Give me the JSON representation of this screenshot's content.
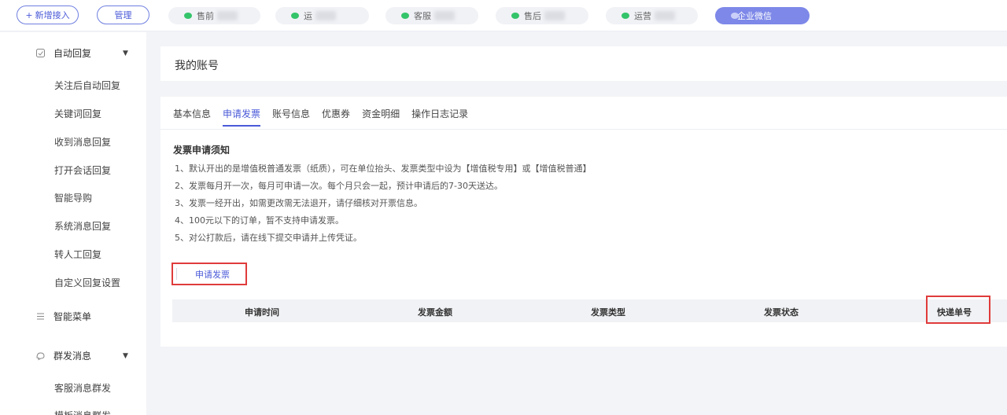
{
  "topbar": {
    "add_label": "新增接入",
    "manage_label": "管理",
    "accounts": [
      {
        "name": "售前"
      },
      {
        "name": "运"
      },
      {
        "name": "客服"
      },
      {
        "name": "售后"
      },
      {
        "name": "运营"
      },
      {
        "name": "企业微信",
        "active": true
      }
    ]
  },
  "sidebar": {
    "group1": {
      "label": "自动回复",
      "icon": "reply-icon"
    },
    "items1": [
      "关注后自动回复",
      "关键词回复",
      "收到消息回复",
      "打开会话回复",
      "智能导购",
      "系统消息回复",
      "转人工回复",
      "自定义回复设置"
    ],
    "group2": {
      "label": "智能菜单",
      "icon": "menu-icon"
    },
    "group3": {
      "label": "群发消息",
      "icon": "broadcast-icon"
    },
    "items3": [
      "客服消息群发",
      "模板消息群发"
    ]
  },
  "main": {
    "page_title": "我的账号",
    "tabs": [
      "基本信息",
      "申请发票",
      "账号信息",
      "优惠券",
      "资金明细",
      "操作日志记录"
    ],
    "active_tab": 1,
    "notice_title": "发票申请须知",
    "rules": [
      "1、默认开出的是增值税普通发票（纸质），可在单位抬头、发票类型中设为【增值税专用】或【增值税普通】",
      "2、发票每月开一次，每月可申请一次。每个月只会一起，预计申请后的7-30天送达。",
      "3、发票一经开出，如需更改需无法退开，请仔细核对开票信息。",
      "4、100元以下的订单，暂不支持申请发票。",
      "5、对公打款后，请在线下提交申请并上传凭证。"
    ],
    "apply_button": "申请发票",
    "table_headers": [
      "申请时间",
      "发票金额",
      "发票类型",
      "发票状态",
      "快递单号"
    ]
  }
}
